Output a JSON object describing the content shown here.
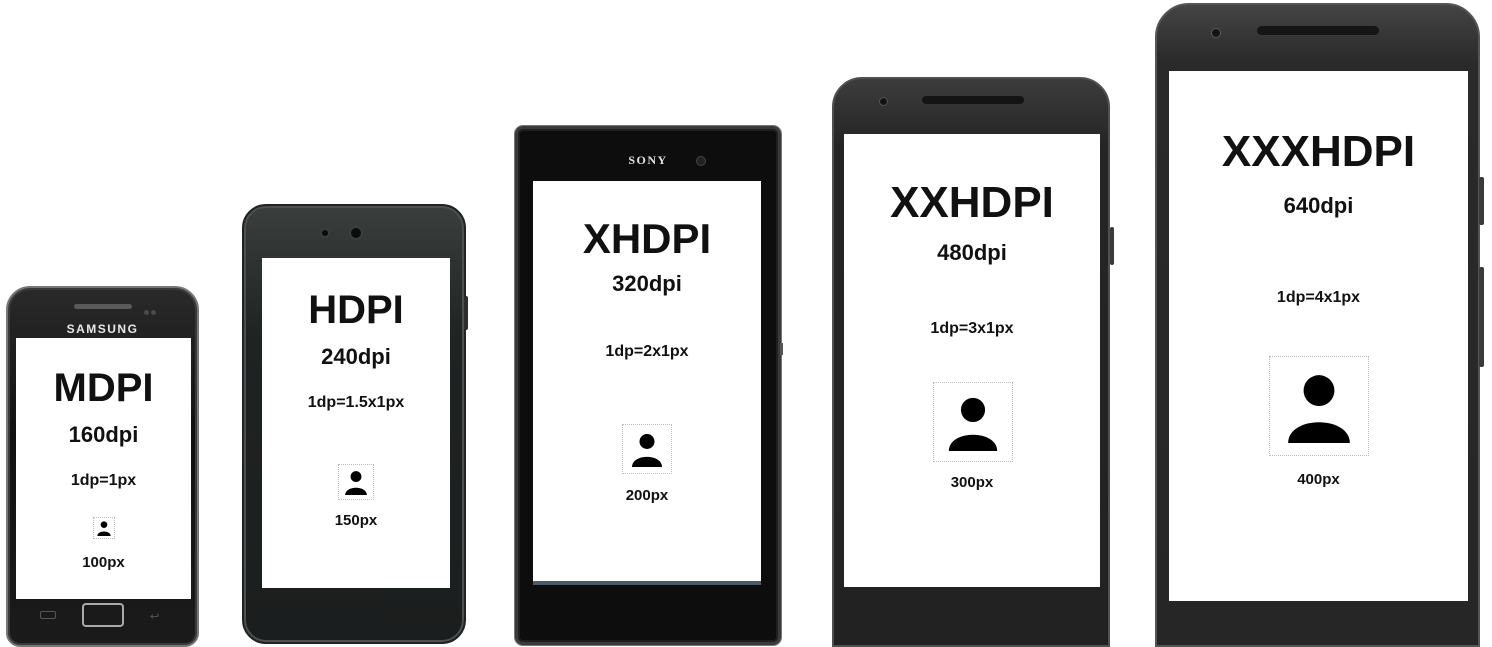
{
  "devices": [
    {
      "brand": "SAMSUNG",
      "density": "MDPI",
      "dpi": "160dpi",
      "ratio": "1dp=1px",
      "icon_size": "100px",
      "icon": "person-icon"
    },
    {
      "brand": "",
      "density": "HDPI",
      "dpi": "240dpi",
      "ratio": "1dp=1.5x1px",
      "icon_size": "150px",
      "icon": "person-icon"
    },
    {
      "brand": "SONY",
      "density": "XHDPI",
      "dpi": "320dpi",
      "ratio": "1dp=2x1px",
      "icon_size": "200px",
      "icon": "person-icon"
    },
    {
      "brand": "",
      "density": "XXHDPI",
      "dpi": "480dpi",
      "ratio": "1dp=3x1px",
      "icon_size": "300px",
      "icon": "person-icon"
    },
    {
      "brand": "",
      "density": "XXXHDPI",
      "dpi": "640dpi",
      "ratio": "1dp=4x1px",
      "icon_size": "400px",
      "icon": "person-icon"
    }
  ],
  "colors": {
    "screen": "#ffffff",
    "text": "#111111",
    "icon": "#000000"
  }
}
